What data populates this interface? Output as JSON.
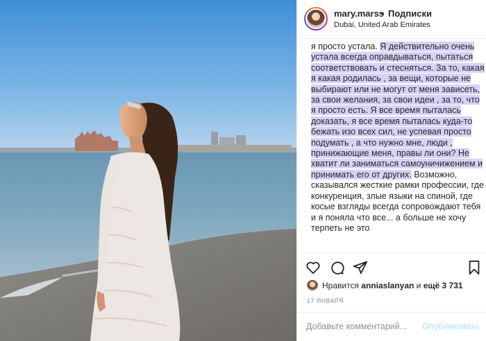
{
  "post": {
    "username": "mary.marss",
    "separator": "•",
    "follow_label": "Подписки",
    "location": "Dubai, United Arab Emirates",
    "caption": {
      "before": "я просто устала.",
      "highlighted": "Я действительно очень устала всегда оправдываться, пытаться соответствовать и стесняться. За то, какая я какая родилась , за вещи, которые не выбирают или не могут от меня зависеть, за свои желания, за свои идеи , за то, что я просто есть. Я все время пыталась доказать, я все время пыталась куда-то бежать изо всех сил, не успевая просто подумать , а что нужно мне, люди , принижающие меня, правы ли они? Не хватит ли заниматься самоуничижением и принимать его от других.",
      "after": "Возможно, сказывался жесткие рамки профессии, где конкуренция, злые языки на спиной, где косые взгляды всегда сопровождают тебя и я поняла что все... а больше не хочу терпеть не это"
    },
    "likes": {
      "prefix": "Нравится",
      "user": "anniaslanyan",
      "connector": "и",
      "others": "ещё 3 731"
    },
    "date": "17 ЯНВАРЯ",
    "comment": {
      "placeholder": "Добавьте комментарий...",
      "post_label": "Опубликовать"
    }
  },
  "icons": {
    "like": "heart-icon",
    "comment": "comment-icon",
    "share": "share-icon",
    "save": "bookmark-icon"
  },
  "colors": {
    "highlight": "#d8d0f6",
    "post_button": "#b2dffc",
    "muted": "#8e8e8e"
  }
}
